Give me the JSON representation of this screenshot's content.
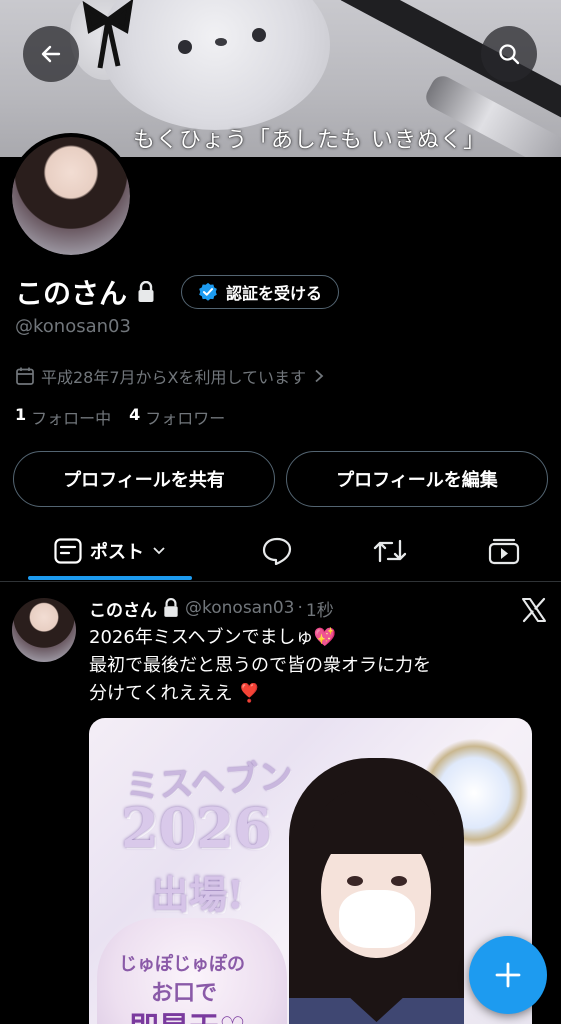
{
  "banner": {
    "caption": "もくひょう「あしたも いきぬく」"
  },
  "nav": {
    "back_icon": "arrow-left-icon",
    "search_icon": "search-icon"
  },
  "profile": {
    "name": "このさん",
    "protected": true,
    "verify_label": "認証を受ける",
    "handle": "@konosan03",
    "joined": "平成28年7月からXを利用しています",
    "following_count": "1",
    "following_label": "フォロー中",
    "followers_count": "4",
    "followers_label": "フォロワー",
    "share_button": "プロフィールを共有",
    "edit_button": "プロフィールを編集"
  },
  "tabs": {
    "posts_label": "ポスト",
    "icons": [
      "posts-icon",
      "reply-icon",
      "repost-icon",
      "media-icon"
    ]
  },
  "post": {
    "name": "このさん",
    "handle": "@konosan03",
    "separator": "·",
    "time": "1秒",
    "lines": [
      "2026年ミスヘブンでましゅ💖",
      "最初で最後だと思うので皆の衆オラに力を",
      "分けてくれえええ ❣️"
    ],
    "image": {
      "title_line1": "ミスヘブン",
      "title_line2": "2026",
      "title_line3": "出場!",
      "sub_line1": "じゅぽじゅぽの",
      "sub_line2": "お口で",
      "sub_line3": "即昇天♡"
    }
  },
  "colors": {
    "accent": "#1d9bf0",
    "background": "#000000",
    "muted_text": "#71767b",
    "border": "#536471"
  }
}
